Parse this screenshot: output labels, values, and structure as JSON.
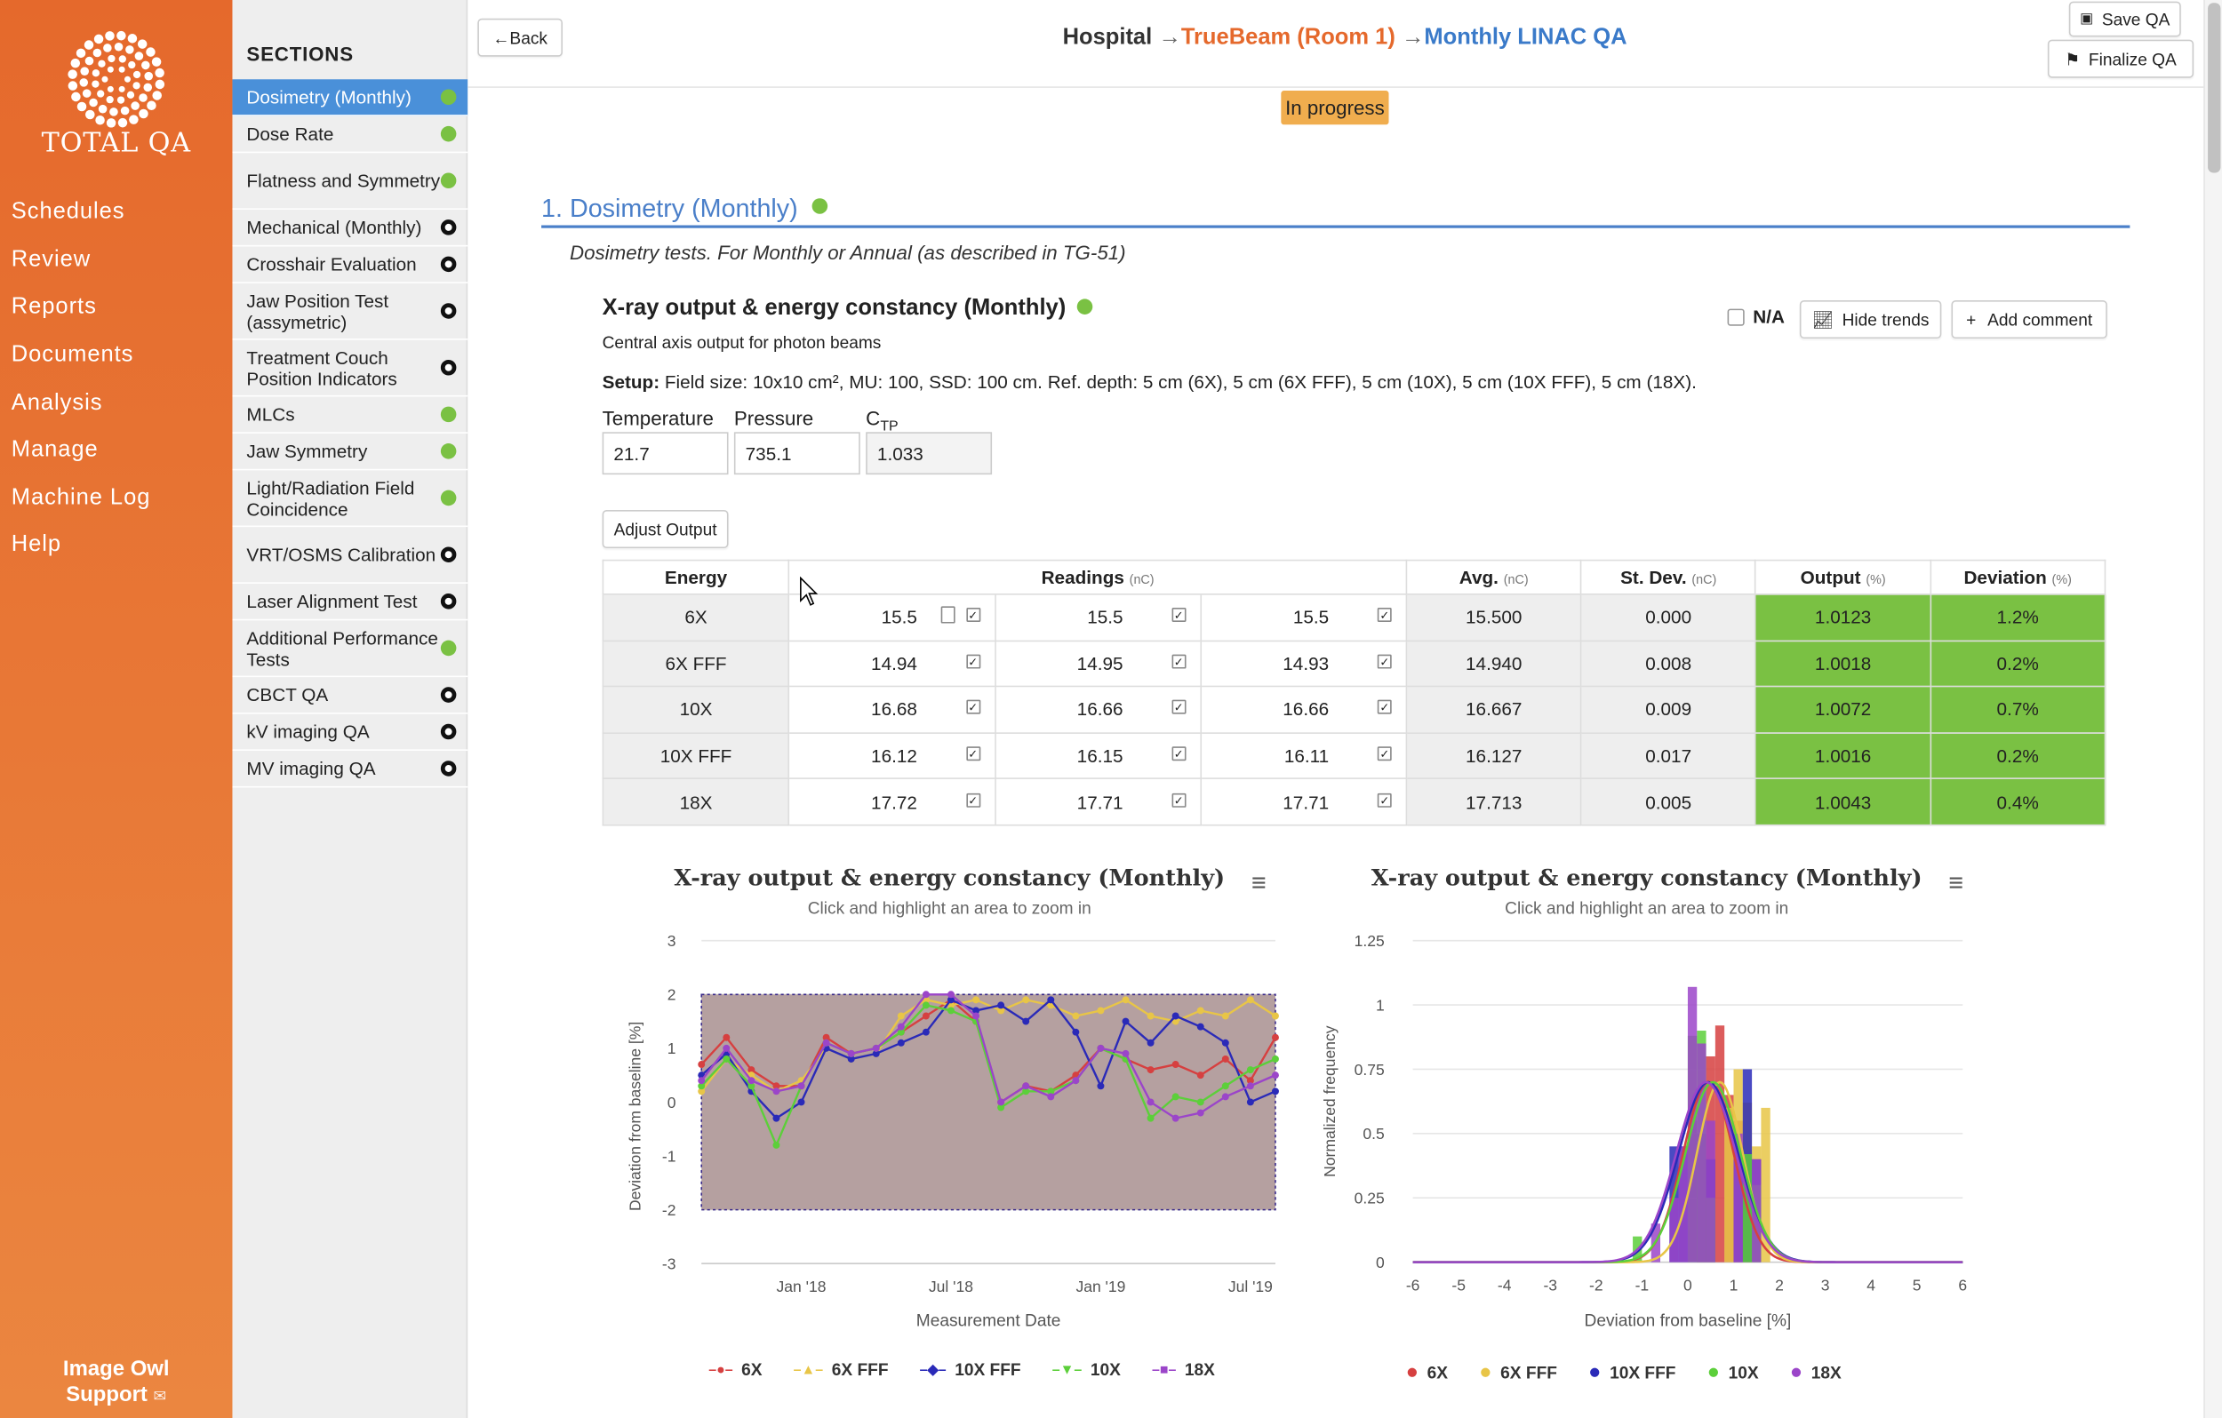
{
  "nav": {
    "logo_text": "TOTAL QA",
    "items": [
      "Schedules",
      "Review",
      "Reports",
      "Documents",
      "Analysis",
      "Manage",
      "Machine Log",
      "Help"
    ],
    "support": [
      "Image Owl",
      "Support"
    ]
  },
  "sections": {
    "heading": "SECTIONS",
    "items": [
      {
        "label": "Dosimetry (Monthly)",
        "status": "complete"
      },
      {
        "label": "Dose Rate",
        "status": "complete"
      },
      {
        "label": "Flatness and Symmetry",
        "status": "complete"
      },
      {
        "label": "Mechanical (Monthly)",
        "status": "incomplete"
      },
      {
        "label": "Crosshair Evaluation",
        "status": "incomplete"
      },
      {
        "label": "Jaw Position Test (assymetric)",
        "status": "incomplete"
      },
      {
        "label": "Treatment Couch Position Indicators",
        "status": "incomplete"
      },
      {
        "label": "MLCs",
        "status": "complete"
      },
      {
        "label": "Jaw Symmetry",
        "status": "complete"
      },
      {
        "label": "Light/Radiation Field Coincidence",
        "status": "complete"
      },
      {
        "label": "VRT/OSMS Calibration",
        "status": "incomplete"
      },
      {
        "label": "Laser Alignment Test",
        "status": "incomplete"
      },
      {
        "label": "Additional Performance Tests",
        "status": "complete"
      },
      {
        "label": "CBCT QA",
        "status": "incomplete"
      },
      {
        "label": "kV imaging QA",
        "status": "incomplete"
      },
      {
        "label": "MV imaging QA",
        "status": "incomplete"
      }
    ]
  },
  "toolbar": {
    "back_label": "Back",
    "save_label": "Save QA",
    "finalize_label": "Finalize QA"
  },
  "breadcrumb": {
    "hospital": "Hospital",
    "machine": "TrueBeam (Room 1)",
    "qa": "Monthly LINAC QA",
    "arrow": "→"
  },
  "status_badge": "In progress",
  "section": {
    "title": "1. Dosimetry (Monthly)",
    "description": "Dosimetry tests. For Monthly or Annual (as described in TG-51)"
  },
  "test": {
    "title": "X-ray output & energy constancy (Monthly)",
    "subtitle": "Central axis output for photon beams",
    "na_label": "N/A",
    "hide_trends_label": "Hide trends",
    "add_comment_label": "Add comment",
    "setup_label": "Setup:",
    "setup_text": " Field size: 10x10 cm², MU: 100, SSD: 100 cm. Ref. depth: 5 cm (6X), 5 cm (6X FFF), 5 cm (10X), 5 cm (10X FFF), 5 cm (18X).",
    "fields": {
      "temperature": {
        "label": "Temperature",
        "value": "21.7"
      },
      "pressure": {
        "label": "Pressure",
        "value": "735.1"
      },
      "ctp": {
        "label": "C",
        "sub": "TP",
        "value": "1.033"
      }
    },
    "adjust_output_label": "Adjust Output"
  },
  "table": {
    "headers": {
      "energy": "Energy",
      "readings": "Readings",
      "avg": "Avg.",
      "stdev": "St. Dev.",
      "output": "Output",
      "deviation": "Deviation",
      "unit_nc": "(nC)",
      "unit_pct": "(%)"
    },
    "rows": [
      {
        "energy": "6X",
        "r1": "15.5",
        "r2": "15.5",
        "r3": "15.5",
        "avg": "15.500",
        "sd": "0.000",
        "output": "1.0123",
        "dev": "1.2%"
      },
      {
        "energy": "6X FFF",
        "r1": "14.94",
        "r2": "14.95",
        "r3": "14.93",
        "avg": "14.940",
        "sd": "0.008",
        "output": "1.0018",
        "dev": "0.2%"
      },
      {
        "energy": "10X",
        "r1": "16.68",
        "r2": "16.66",
        "r3": "16.66",
        "avg": "16.667",
        "sd": "0.009",
        "output": "1.0072",
        "dev": "0.7%"
      },
      {
        "energy": "10X FFF",
        "r1": "16.12",
        "r2": "16.15",
        "r3": "16.11",
        "avg": "16.127",
        "sd": "0.017",
        "output": "1.0016",
        "dev": "0.2%"
      },
      {
        "energy": "18X",
        "r1": "17.72",
        "r2": "17.71",
        "r3": "17.71",
        "avg": "17.713",
        "sd": "0.005",
        "output": "1.0043",
        "dev": "0.4%"
      }
    ]
  },
  "colors": {
    "accent": "#4a7fc9",
    "brand": "#e5692c",
    "ok": "#7ac143",
    "progress": "#f0ad4e",
    "6X": "#d64040",
    "6X FFF": "#e8c547",
    "10X FFF": "#2a2ab8",
    "10X": "#5ccf3a",
    "18X": "#9b45c9"
  },
  "chart_data": [
    {
      "type": "line",
      "title": "X-ray output & energy constancy (Monthly)",
      "subtitle": "Click and highlight an area to zoom in",
      "xlabel": "Measurement Date",
      "ylabel": "Deviation from baseline [%]",
      "ylim": [
        -3,
        3
      ],
      "yticks": [
        "3",
        "2",
        "1",
        "0",
        "-1",
        "-2",
        "-3"
      ],
      "xlim": [
        "2017-09",
        "2019-08"
      ],
      "xticks": [
        {
          "label": "Jan '18",
          "date": "2018-01"
        },
        {
          "label": "Jul '18",
          "date": "2018-07"
        },
        {
          "label": "Jan '19",
          "date": "2019-01"
        },
        {
          "label": "Jul '19",
          "date": "2019-07"
        }
      ],
      "tolerance_band": [
        -2,
        2
      ],
      "x": [
        "2017-09",
        "2017-10",
        "2017-11",
        "2017-12",
        "2018-01",
        "2018-02",
        "2018-03",
        "2018-04",
        "2018-05",
        "2018-06",
        "2018-07",
        "2018-08",
        "2018-09",
        "2018-10",
        "2018-11",
        "2018-12",
        "2019-01",
        "2019-02",
        "2019-03",
        "2019-04",
        "2019-05",
        "2019-06",
        "2019-07",
        "2019-08"
      ],
      "series": [
        {
          "name": "6X",
          "marker": "●",
          "values": [
            0.7,
            1.2,
            0.6,
            0.3,
            0.3,
            1.2,
            0.9,
            1.0,
            1.3,
            1.6,
            1.9,
            1.5,
            0.0,
            0.3,
            0.2,
            0.5,
            1.0,
            0.8,
            0.6,
            0.7,
            0.5,
            0.8,
            0.4,
            1.2
          ]
        },
        {
          "name": "6X FFF",
          "marker": "▲",
          "values": [
            0.2,
            0.8,
            0.5,
            0.2,
            0.4,
            1.0,
            0.8,
            0.9,
            1.6,
            1.9,
            1.8,
            1.9,
            1.7,
            1.9,
            1.8,
            1.6,
            1.7,
            1.9,
            1.6,
            1.5,
            1.7,
            1.6,
            1.9,
            1.6
          ]
        },
        {
          "name": "10X FFF",
          "marker": "◆",
          "values": [
            0.5,
            0.9,
            0.2,
            -0.3,
            0.0,
            1.0,
            0.8,
            0.9,
            1.1,
            1.3,
            1.9,
            1.7,
            1.8,
            1.5,
            1.9,
            1.3,
            0.3,
            1.5,
            1.1,
            1.6,
            1.4,
            1.1,
            0.0,
            0.2
          ]
        },
        {
          "name": "10X",
          "marker": "▼",
          "values": [
            0.3,
            0.8,
            0.3,
            -0.8,
            0.3,
            1.1,
            0.9,
            1.0,
            1.3,
            1.8,
            1.7,
            1.5,
            -0.1,
            0.2,
            0.2,
            0.4,
            1.0,
            0.8,
            -0.3,
            0.1,
            0.0,
            0.3,
            0.6,
            0.8
          ]
        },
        {
          "name": "18X",
          "marker": "■",
          "values": [
            0.4,
            1.0,
            0.4,
            0.2,
            0.3,
            1.1,
            0.9,
            1.0,
            1.4,
            2.0,
            2.0,
            1.6,
            0.0,
            0.3,
            0.1,
            0.4,
            1.0,
            0.9,
            0.0,
            -0.3,
            -0.2,
            0.1,
            0.3,
            0.5
          ]
        }
      ],
      "grid": true,
      "legend": "bottom"
    },
    {
      "type": "bar",
      "title": "X-ray output & energy constancy (Monthly)",
      "subtitle": "Click and highlight an area to zoom in",
      "xlabel": "Deviation from baseline [%]",
      "ylabel": "Normalized frequency",
      "xlim": [
        -6,
        6
      ],
      "ylim": [
        0,
        1.25
      ],
      "xticks": [
        "-6",
        "-5",
        "-4",
        "-3",
        "-2",
        "-1",
        "0",
        "1",
        "2",
        "3",
        "4",
        "5",
        "6"
      ],
      "yticks": [
        "1.25",
        "1",
        "0.75",
        "0.5",
        "0.25",
        "0"
      ],
      "bin_width": 0.2,
      "series": [
        {
          "name": "6X",
          "bins": [
            [
              0.3,
              0.45
            ],
            [
              0.5,
              0.8
            ],
            [
              0.7,
              0.92
            ],
            [
              0.9,
              0.65
            ],
            [
              1.1,
              0.55
            ],
            [
              1.3,
              0.4
            ]
          ],
          "curve": {
            "mean": 0.45,
            "sd": 0.55
          }
        },
        {
          "name": "6X FFF",
          "bins": [
            [
              0.9,
              0.6
            ],
            [
              1.1,
              0.75
            ],
            [
              1.3,
              0.62
            ],
            [
              1.5,
              0.45
            ],
            [
              1.7,
              0.6
            ]
          ],
          "curve": {
            "mean": 0.7,
            "sd": 0.5
          }
        },
        {
          "name": "10X FFF",
          "bins": [
            [
              -0.3,
              0.45
            ],
            [
              -0.1,
              0.45
            ],
            [
              0.1,
              0.55
            ],
            [
              0.3,
              0.5
            ],
            [
              0.5,
              0.4
            ],
            [
              1.1,
              0.45
            ],
            [
              1.3,
              0.75
            ],
            [
              1.5,
              0.4
            ]
          ],
          "curve": {
            "mean": 0.45,
            "sd": 0.65
          }
        },
        {
          "name": "10X",
          "bins": [
            [
              -1.1,
              0.1
            ],
            [
              0.1,
              0.88
            ],
            [
              0.3,
              0.9
            ],
            [
              0.5,
              0.25
            ],
            [
              1.3,
              0.42
            ],
            [
              1.5,
              0.3
            ]
          ],
          "curve": {
            "mean": 0.55,
            "sd": 0.6
          }
        },
        {
          "name": "18X",
          "bins": [
            [
              -0.7,
              0.15
            ],
            [
              -0.3,
              0.25
            ],
            [
              -0.1,
              0.45
            ],
            [
              0.1,
              1.07
            ],
            [
              0.3,
              0.85
            ],
            [
              0.5,
              0.55
            ],
            [
              1.1,
              0.5
            ],
            [
              1.5,
              0.4
            ]
          ],
          "curve": {
            "mean": 0.4,
            "sd": 0.65
          }
        }
      ],
      "grid": true,
      "legend": "bottom"
    }
  ]
}
